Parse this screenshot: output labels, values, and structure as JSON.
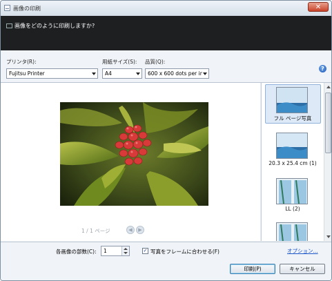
{
  "window": {
    "title": "画像の印刷",
    "close_label": "✕"
  },
  "header": {
    "prompt": "画像をどのように印刷しますか?"
  },
  "options": {
    "printer_label": "プリンタ(R):",
    "printer_value": "Fujitsu Printer",
    "paper_size_label": "用紙サイズ(S):",
    "paper_size_value": "A4",
    "quality_label": "品質(Q):",
    "quality_value": "600 x 600 dots per ir",
    "help_label": "?"
  },
  "preview": {
    "page_indicator": "1 / 1 ページ",
    "prev_icon": "◀",
    "next_icon": "▶"
  },
  "layouts": [
    {
      "label": "フル ページ写真",
      "selected": true
    },
    {
      "label": "20.3 x 25.4 cm (1)",
      "selected": false
    },
    {
      "label": "LL (2)",
      "selected": false
    },
    {
      "label": "",
      "selected": false
    }
  ],
  "bottom": {
    "copies_label": "各画像の部数(C):",
    "copies_value": "1",
    "fit_checkbox_checked": true,
    "fit_label": "写真をフレームに合わせる(F)",
    "options_link": "オプション...",
    "print_button": "印刷(P)",
    "cancel_button": "キャンセル"
  },
  "colors": {
    "accent_link": "#1a55c8",
    "header_bg": "#1d1f21",
    "selected_bg": "#dde9f7"
  }
}
